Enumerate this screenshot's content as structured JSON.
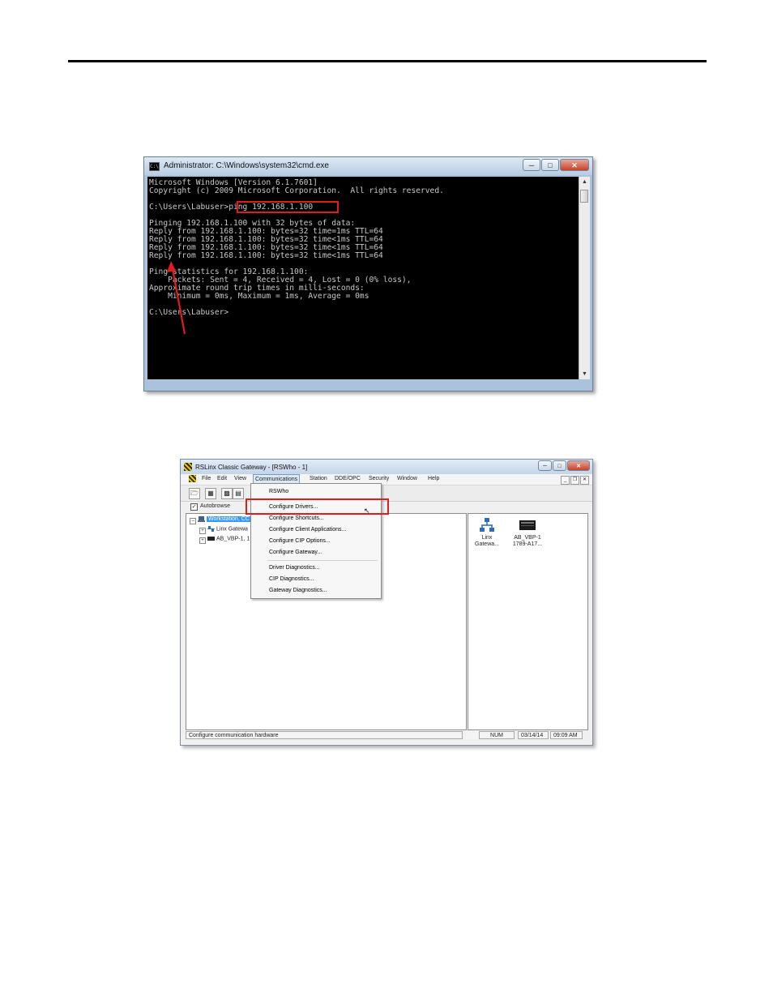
{
  "cmd": {
    "title": "Administrator: C:\\Windows\\system32\\cmd.exe",
    "console_lines": [
      "Microsoft Windows [Version 6.1.7601]",
      "Copyright (c) 2009 Microsoft Corporation.  All rights reserved.",
      "",
      "C:\\Users\\Labuser>ping 192.168.1.100",
      "",
      "Pinging 192.168.1.100 with 32 bytes of data:",
      "Reply from 192.168.1.100: bytes=32 time=1ms TTL=64",
      "Reply from 192.168.1.100: bytes=32 time<1ms TTL=64",
      "Reply from 192.168.1.100: bytes=32 time<1ms TTL=64",
      "Reply from 192.168.1.100: bytes=32 time<1ms TTL=64",
      "",
      "Ping statistics for 192.168.1.100:",
      "    Packets: Sent = 4, Received = 4, Lost = 0 (0% loss),",
      "Approximate round trip times in milli-seconds:",
      "    Minimum = 0ms, Maximum = 1ms, Average = 0ms",
      "",
      "C:\\Users\\Labuser>"
    ],
    "highlight_color": "#e21b1b"
  },
  "rslinx": {
    "title": "RSLinx Classic Gateway - [RSWho - 1]",
    "menu": [
      "File",
      "Edit",
      "View",
      "Communications",
      "Station",
      "DDE/OPC",
      "Security",
      "Window",
      "Help"
    ],
    "autobrowse_label": "Autobrowse",
    "tree": {
      "root": "Workstation, CC",
      "child1": "Linx Gatewa",
      "child2": "AB_VBP-1, 1"
    },
    "right_icons": {
      "linx": [
        "Linx",
        "Gatewa..."
      ],
      "vbp": [
        "AB_VBP-1",
        "1789-A17..."
      ]
    },
    "dropdown": {
      "items_top": [
        "RSWho"
      ],
      "items_mid": [
        "Configure Drivers...",
        "Configure Shortcuts...",
        "Configure Client Applications...",
        "Configure CIP Options...",
        "Configure Gateway..."
      ],
      "items_bottom": [
        "Driver Diagnostics...",
        "CIP Diagnostics...",
        "Gateway Diagnostics..."
      ]
    },
    "status": {
      "message": "Configure communication hardware",
      "num": "NUM",
      "date": "03/14/14",
      "time": "09:09 AM"
    }
  }
}
